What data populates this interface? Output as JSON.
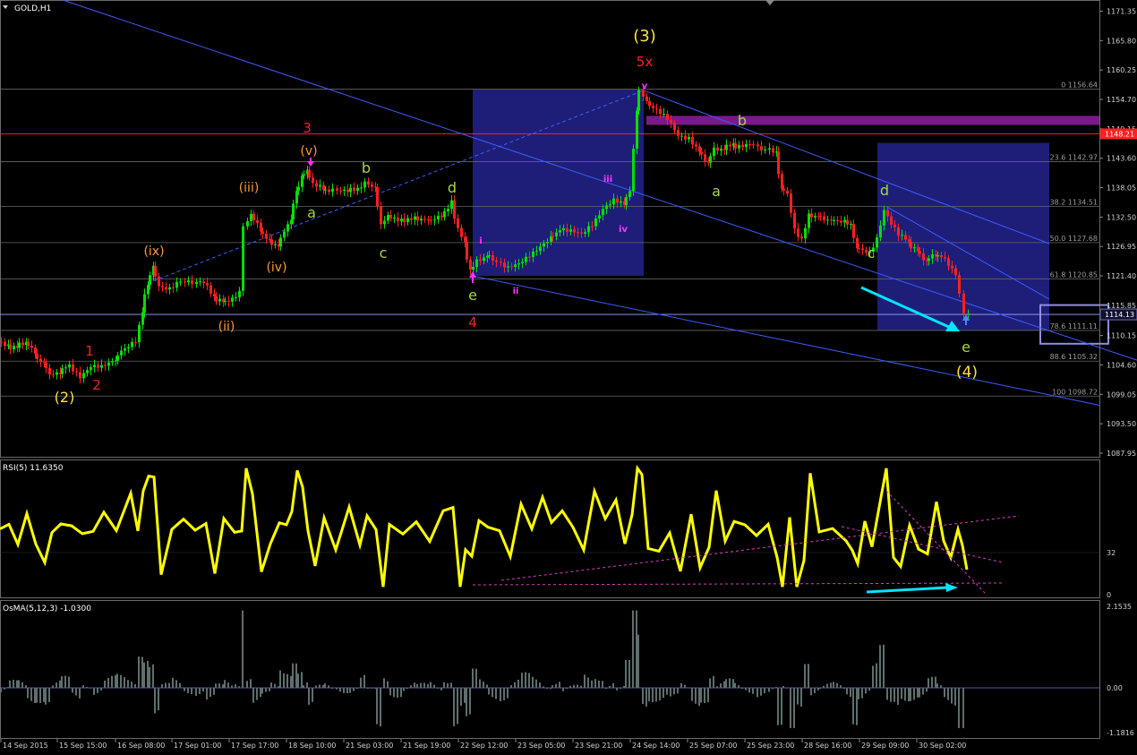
{
  "window": {
    "symbol_title": "GOLD,H1"
  },
  "colors": {
    "background": "#000000",
    "bull_candle": "#00e000",
    "bear_candle": "#ff2020",
    "rsi_line": "#ffff00",
    "channel_lines": "#3c5cff",
    "box_fill": "#1e1e78",
    "resistance_band": "#7a1a8a",
    "horizontal_red": "#ff2020",
    "annotation_arrow": "#00e5ff",
    "label_yellow": "#ffe040",
    "label_red": "#ff2020",
    "label_orange": "#ff9933",
    "label_green": "#a8d840",
    "label_magenta": "#ff33ff"
  },
  "chart_data": [
    {
      "type": "line",
      "title": "GOLD,H1",
      "ylim": [
        1087.95,
        1171.35
      ],
      "y_ticks": [
        "1171.35",
        "1165.80",
        "1160.25",
        "1154.70",
        "1149.15",
        "1143.60",
        "1138.05",
        "1132.50",
        "1126.95",
        "1121.40",
        "1115.85",
        "1110.15",
        "1104.60",
        "1099.05",
        "1093.50",
        "1087.95"
      ],
      "x_ticks": [
        "14 Sep 2015",
        "15 Sep 15:00",
        "16 Sep 08:00",
        "17 Sep 01:00",
        "17 Sep 17:00",
        "18 Sep 10:00",
        "21 Sep 03:00",
        "21 Sep 19:00",
        "22 Sep 12:00",
        "23 Sep 05:00",
        "23 Sep 21:00",
        "24 Sep 14:00",
        "25 Sep 07:00",
        "25 Sep 23:00",
        "28 Sep 16:00",
        "29 Sep 09:00",
        "30 Sep 02:00"
      ],
      "current_price_label": "1114.13",
      "horizontal_level_label": "1148.21",
      "fib_levels": [
        {
          "label": "0 1156.64",
          "value": 1156.64
        },
        {
          "label": "23.6 1142.97",
          "value": 1142.97
        },
        {
          "label": "38.2 1134.51",
          "value": 1134.51
        },
        {
          "label": "50.0 1127.68",
          "value": 1127.68
        },
        {
          "label": "61.8 1120.85",
          "value": 1120.85
        },
        {
          "label": "78.6 1111.11",
          "value": 1111.11
        },
        {
          "label": "88.6 1105.32",
          "value": 1105.32
        },
        {
          "label": "100 1098.72",
          "value": 1098.72
        }
      ],
      "price_path": [
        {
          "x": 0,
          "y": 1109.0
        },
        {
          "x": 10,
          "y": 1108.0
        },
        {
          "x": 20,
          "y": 1108.3
        },
        {
          "x": 30,
          "y": 1108.8
        },
        {
          "x": 40,
          "y": 1106.7
        },
        {
          "x": 50,
          "y": 1104.8
        },
        {
          "x": 58,
          "y": 1103.0
        },
        {
          "x": 68,
          "y": 1103.4
        },
        {
          "x": 80,
          "y": 1104.6
        },
        {
          "x": 92,
          "y": 1102.6
        },
        {
          "x": 104,
          "y": 1104.2
        },
        {
          "x": 116,
          "y": 1104.0
        },
        {
          "x": 130,
          "y": 1105.8
        },
        {
          "x": 146,
          "y": 1108.0
        },
        {
          "x": 154,
          "y": 1109.3
        },
        {
          "x": 160,
          "y": 1115.0
        },
        {
          "x": 166,
          "y": 1119.8
        },
        {
          "x": 172,
          "y": 1123.5
        },
        {
          "x": 180,
          "y": 1119.6
        },
        {
          "x": 192,
          "y": 1119.2
        },
        {
          "x": 205,
          "y": 1120.3
        },
        {
          "x": 218,
          "y": 1120.4
        },
        {
          "x": 230,
          "y": 1120.0
        },
        {
          "x": 240,
          "y": 1117.1
        },
        {
          "x": 250,
          "y": 1116.6
        },
        {
          "x": 262,
          "y": 1117.3
        },
        {
          "x": 270,
          "y": 1118.4
        },
        {
          "x": 275,
          "y": 1130.8
        },
        {
          "x": 282,
          "y": 1132.8
        },
        {
          "x": 292,
          "y": 1130.0
        },
        {
          "x": 302,
          "y": 1127.7
        },
        {
          "x": 312,
          "y": 1127.4
        },
        {
          "x": 320,
          "y": 1129.8
        },
        {
          "x": 326,
          "y": 1132.5
        },
        {
          "x": 332,
          "y": 1137.2
        },
        {
          "x": 338,
          "y": 1140.3
        },
        {
          "x": 344,
          "y": 1141.2
        },
        {
          "x": 352,
          "y": 1138.5
        },
        {
          "x": 362,
          "y": 1137.7
        },
        {
          "x": 375,
          "y": 1137.4
        },
        {
          "x": 390,
          "y": 1137.8
        },
        {
          "x": 402,
          "y": 1138.0
        },
        {
          "x": 410,
          "y": 1139.3
        },
        {
          "x": 420,
          "y": 1137.8
        },
        {
          "x": 428,
          "y": 1131.5
        },
        {
          "x": 435,
          "y": 1132.9
        },
        {
          "x": 450,
          "y": 1132.0
        },
        {
          "x": 465,
          "y": 1132.5
        },
        {
          "x": 480,
          "y": 1132.0
        },
        {
          "x": 495,
          "y": 1132.6
        },
        {
          "x": 506,
          "y": 1135.2
        },
        {
          "x": 514,
          "y": 1130.2
        },
        {
          "x": 520,
          "y": 1127.5
        },
        {
          "x": 527,
          "y": 1122.6
        },
        {
          "x": 535,
          "y": 1124.5
        },
        {
          "x": 545,
          "y": 1125.3
        },
        {
          "x": 558,
          "y": 1124.2
        },
        {
          "x": 570,
          "y": 1122.7
        },
        {
          "x": 582,
          "y": 1123.5
        },
        {
          "x": 594,
          "y": 1125.5
        },
        {
          "x": 606,
          "y": 1127.1
        },
        {
          "x": 616,
          "y": 1128.4
        },
        {
          "x": 628,
          "y": 1130.5
        },
        {
          "x": 640,
          "y": 1129.8
        },
        {
          "x": 652,
          "y": 1129.0
        },
        {
          "x": 664,
          "y": 1131.2
        },
        {
          "x": 676,
          "y": 1134.3
        },
        {
          "x": 688,
          "y": 1135.6
        },
        {
          "x": 698,
          "y": 1134.6
        },
        {
          "x": 706,
          "y": 1137.8
        },
        {
          "x": 712,
          "y": 1152.5
        },
        {
          "x": 717,
          "y": 1156.4
        },
        {
          "x": 724,
          "y": 1154.3
        },
        {
          "x": 736,
          "y": 1152.6
        },
        {
          "x": 748,
          "y": 1150.8
        },
        {
          "x": 760,
          "y": 1148.0
        },
        {
          "x": 772,
          "y": 1147.6
        },
        {
          "x": 782,
          "y": 1144.8
        },
        {
          "x": 792,
          "y": 1142.9
        },
        {
          "x": 800,
          "y": 1145.1
        },
        {
          "x": 810,
          "y": 1145.4
        },
        {
          "x": 820,
          "y": 1146.0
        },
        {
          "x": 832,
          "y": 1145.9
        },
        {
          "x": 845,
          "y": 1146.0
        },
        {
          "x": 858,
          "y": 1145.4
        },
        {
          "x": 868,
          "y": 1144.3
        },
        {
          "x": 874,
          "y": 1137.7
        },
        {
          "x": 882,
          "y": 1137.0
        },
        {
          "x": 890,
          "y": 1130.4
        },
        {
          "x": 898,
          "y": 1128.4
        },
        {
          "x": 905,
          "y": 1133.0
        },
        {
          "x": 915,
          "y": 1132.6
        },
        {
          "x": 930,
          "y": 1132.1
        },
        {
          "x": 945,
          "y": 1131.9
        },
        {
          "x": 952,
          "y": 1131.2
        },
        {
          "x": 958,
          "y": 1126.6
        },
        {
          "x": 966,
          "y": 1125.9
        },
        {
          "x": 974,
          "y": 1125.6
        },
        {
          "x": 982,
          "y": 1128.6
        },
        {
          "x": 990,
          "y": 1134.1
        },
        {
          "x": 998,
          "y": 1131.4
        },
        {
          "x": 1006,
          "y": 1129.1
        },
        {
          "x": 1016,
          "y": 1127.6
        },
        {
          "x": 1026,
          "y": 1126.1
        },
        {
          "x": 1036,
          "y": 1124.3
        },
        {
          "x": 1046,
          "y": 1125.3
        },
        {
          "x": 1054,
          "y": 1125.0
        },
        {
          "x": 1062,
          "y": 1123.3
        },
        {
          "x": 1070,
          "y": 1121.5
        },
        {
          "x": 1075,
          "y": 1118.1
        },
        {
          "x": 1080,
          "y": 1114.1
        }
      ],
      "wave_labels": [
        {
          "text": "(2)",
          "color": "yellow"
        },
        {
          "text": "1",
          "color": "red"
        },
        {
          "text": "2",
          "color": "red"
        },
        {
          "text": "(ix)",
          "color": "orange"
        },
        {
          "text": "(ii)",
          "color": "orange"
        },
        {
          "text": "(iii)",
          "color": "orange"
        },
        {
          "text": "(iv)",
          "color": "orange"
        },
        {
          "text": "(v)",
          "color": "orange"
        },
        {
          "text": "3",
          "color": "red"
        },
        {
          "text": "a",
          "color": "green"
        },
        {
          "text": "b",
          "color": "green"
        },
        {
          "text": "c",
          "color": "green"
        },
        {
          "text": "d",
          "color": "green"
        },
        {
          "text": "e",
          "color": "green"
        },
        {
          "text": "4",
          "color": "red"
        },
        {
          "text": "i",
          "color": "magenta"
        },
        {
          "text": "ii",
          "color": "magenta"
        },
        {
          "text": "iii",
          "color": "magenta"
        },
        {
          "text": "iv",
          "color": "magenta"
        },
        {
          "text": "v",
          "color": "magenta"
        },
        {
          "text": "(3)",
          "color": "yellow"
        },
        {
          "text": "5x",
          "color": "red"
        },
        {
          "text": "a",
          "color": "green"
        },
        {
          "text": "b",
          "color": "green"
        },
        {
          "text": "c",
          "color": "green"
        },
        {
          "text": "d",
          "color": "green"
        },
        {
          "text": "e",
          "color": "green"
        },
        {
          "text": "(4)",
          "color": "yellow"
        }
      ]
    },
    {
      "type": "line",
      "title": "RSI(5) 11.6350",
      "ylim": [
        0,
        100
      ],
      "y_ticks": [
        "32",
        "0"
      ],
      "levels": [
        32
      ]
    },
    {
      "type": "bar",
      "title": "OsMA(5,12,3) -1.0300",
      "y_ticks": [
        "2.1535",
        "0.00",
        "-1.1816"
      ],
      "ylim": [
        -1.1816,
        2.1535
      ]
    }
  ]
}
